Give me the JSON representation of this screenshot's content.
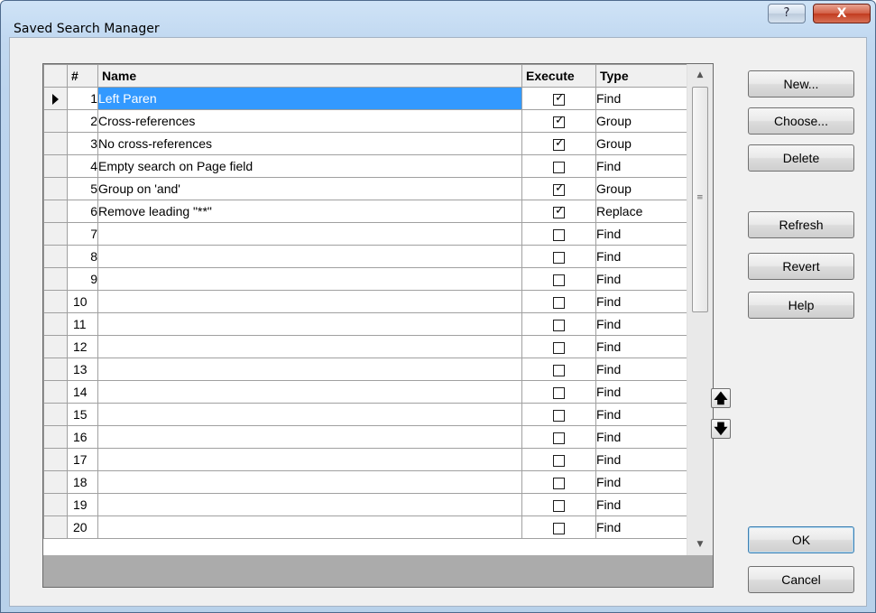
{
  "window": {
    "title": "Saved Search Manager",
    "help_glyph": "?",
    "close_glyph": "X"
  },
  "grid": {
    "headers": {
      "number": "#",
      "name": "Name",
      "execute": "Execute",
      "type": "Type"
    },
    "selected_row": 1,
    "rows": [
      {
        "num": "1",
        "name": "Left Paren",
        "execute": true,
        "type": "Find"
      },
      {
        "num": "2",
        "name": "Cross-references",
        "execute": true,
        "type": "Group"
      },
      {
        "num": "3",
        "name": "No cross-references",
        "execute": true,
        "type": "Group"
      },
      {
        "num": "4",
        "name": "Empty search on Page field",
        "execute": false,
        "type": "Find"
      },
      {
        "num": "5",
        "name": "Group on 'and'",
        "execute": true,
        "type": "Group"
      },
      {
        "num": "6",
        "name": "Remove leading \"**\"",
        "execute": true,
        "type": "Replace"
      },
      {
        "num": "7",
        "name": "",
        "execute": false,
        "type": "Find"
      },
      {
        "num": "8",
        "name": "",
        "execute": false,
        "type": "Find"
      },
      {
        "num": "9",
        "name": "",
        "execute": false,
        "type": "Find"
      },
      {
        "num": "10",
        "name": "",
        "execute": false,
        "type": "Find"
      },
      {
        "num": "11",
        "name": "",
        "execute": false,
        "type": "Find"
      },
      {
        "num": "12",
        "name": "",
        "execute": false,
        "type": "Find"
      },
      {
        "num": "13",
        "name": "",
        "execute": false,
        "type": "Find"
      },
      {
        "num": "14",
        "name": "",
        "execute": false,
        "type": "Find"
      },
      {
        "num": "15",
        "name": "",
        "execute": false,
        "type": "Find"
      },
      {
        "num": "16",
        "name": "",
        "execute": false,
        "type": "Find"
      },
      {
        "num": "17",
        "name": "",
        "execute": false,
        "type": "Find"
      },
      {
        "num": "18",
        "name": "",
        "execute": false,
        "type": "Find"
      },
      {
        "num": "19",
        "name": "",
        "execute": false,
        "type": "Find"
      },
      {
        "num": "20",
        "name": "",
        "execute": false,
        "type": "Find"
      }
    ]
  },
  "scrollbar": {
    "up_glyph": "▲",
    "down_glyph": "▼",
    "grip_glyph": "≡"
  },
  "buttons": {
    "new": "New...",
    "choose": "Choose...",
    "delete": "Delete",
    "refresh": "Refresh",
    "revert": "Revert",
    "help": "Help",
    "ok": "OK",
    "cancel": "Cancel"
  },
  "move": {
    "up_glyph": "🡅",
    "down_glyph": "🡇"
  },
  "icons": {
    "row_indicator": "current-row-arrow-icon",
    "checkbox_checked": "check-icon",
    "move_up": "arrow-up-icon",
    "move_down": "arrow-down-icon"
  },
  "colors": {
    "selection": "#3399ff",
    "close_button": "#c23b1f",
    "title_bar": "#c2d9f1"
  }
}
